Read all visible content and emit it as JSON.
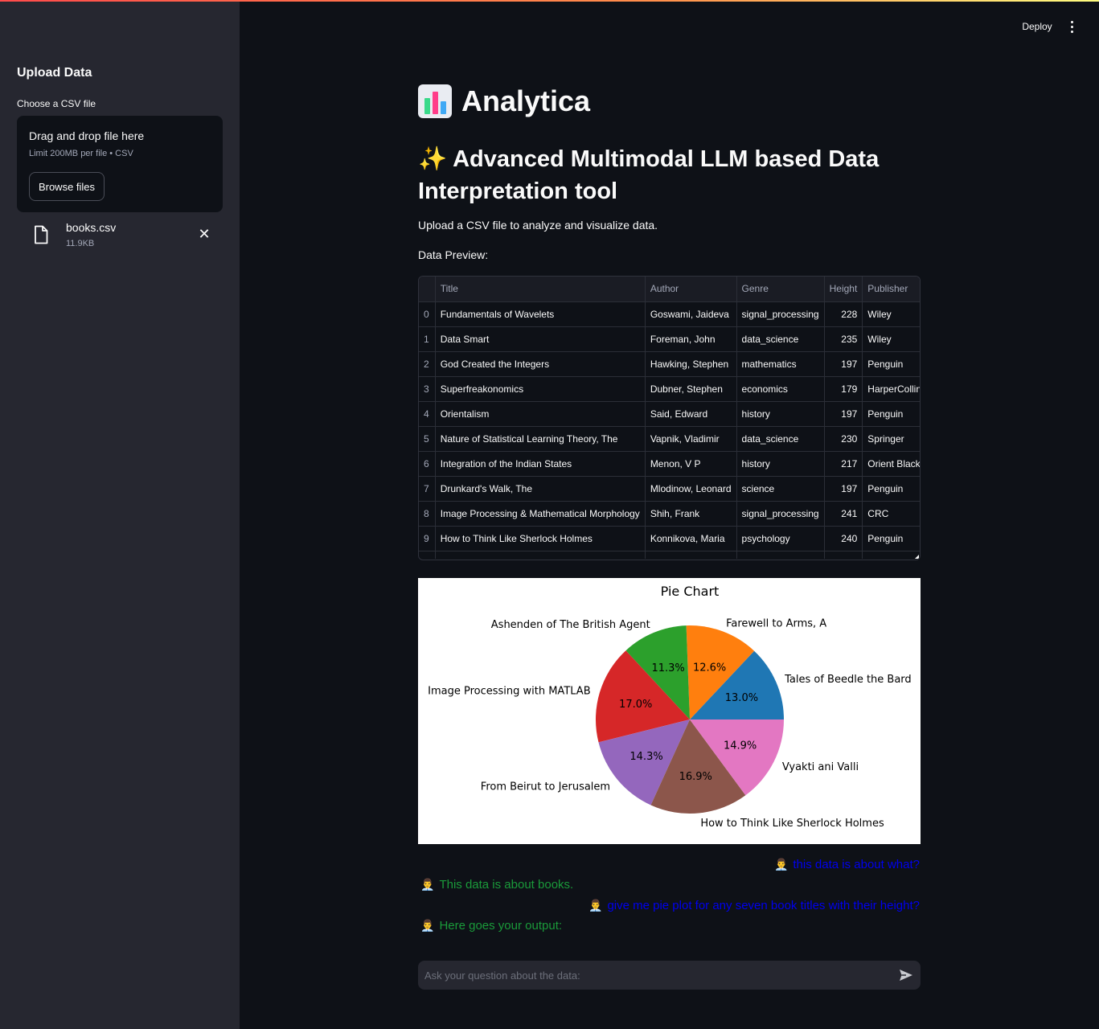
{
  "header": {
    "deploy_label": "Deploy",
    "menu_icon": "kebab-menu-icon"
  },
  "sidebar": {
    "title": "Upload Data",
    "uploader_label": "Choose a CSV file",
    "dropzone_title": "Drag and drop file here",
    "dropzone_limit": "Limit 200MB per file • CSV",
    "browse_label": "Browse files",
    "file": {
      "name": "books.csv",
      "size": "11.9KB"
    }
  },
  "main": {
    "title": "Analytica",
    "title_icon": "bar-chart-icon",
    "subtitle_icon": "✨",
    "subtitle": "Advanced Multimodal LLM based Data Interpretation tool",
    "intro": "Upload a CSV file to analyze and visualize data.",
    "preview_label": "Data Preview:"
  },
  "table": {
    "columns": [
      "",
      "Title",
      "Author",
      "Genre",
      "Height",
      "Publisher"
    ],
    "rows": [
      [
        "0",
        "Fundamentals of Wavelets",
        "Goswami, Jaideva",
        "signal_processing",
        "228",
        "Wiley"
      ],
      [
        "1",
        "Data Smart",
        "Foreman, John",
        "data_science",
        "235",
        "Wiley"
      ],
      [
        "2",
        "God Created the Integers",
        "Hawking, Stephen",
        "mathematics",
        "197",
        "Penguin"
      ],
      [
        "3",
        "Superfreakonomics",
        "Dubner, Stephen",
        "economics",
        "179",
        "HarperCollins"
      ],
      [
        "4",
        "Orientalism",
        "Said, Edward",
        "history",
        "197",
        "Penguin"
      ],
      [
        "5",
        "Nature of Statistical Learning Theory, The",
        "Vapnik, Vladimir",
        "data_science",
        "230",
        "Springer"
      ],
      [
        "6",
        "Integration of the Indian States",
        "Menon, V P",
        "history",
        "217",
        "Orient Blackswan"
      ],
      [
        "7",
        "Drunkard's Walk, The",
        "Mlodinow, Leonard",
        "science",
        "197",
        "Penguin"
      ],
      [
        "8",
        "Image Processing & Mathematical Morphology",
        "Shih, Frank",
        "signal_processing",
        "241",
        "CRC"
      ],
      [
        "9",
        "How to Think Like Sherlock Holmes",
        "Konnikova, Maria",
        "psychology",
        "240",
        "Penguin"
      ]
    ]
  },
  "chart_data": {
    "type": "pie",
    "title": "Pie Chart",
    "labels": [
      "Tales of Beedle the Bard",
      "Farewell to Arms, A",
      "Ashenden of The British Agent",
      "Image Processing with MATLAB",
      "From Beirut to Jerusalem",
      "How to Think Like Sherlock Holmes",
      "Vyakti ani Valli"
    ],
    "percent_labels": [
      "13.0%",
      "12.6%",
      "11.3%",
      "17.0%",
      "14.3%",
      "16.9%",
      "14.9%"
    ],
    "values": [
      13.0,
      12.6,
      11.3,
      17.0,
      14.3,
      16.9,
      14.9
    ],
    "colors": [
      "#1f77b4",
      "#ff7f0e",
      "#2ca02c",
      "#d62728",
      "#9467bd",
      "#8c564b",
      "#e377c2"
    ],
    "start_angle_deg": 0,
    "direction": "counterclockwise"
  },
  "chat": {
    "messages": [
      {
        "role": "user",
        "avatar": "👨‍💼",
        "text": "this data is about what?"
      },
      {
        "role": "bot",
        "avatar": "👨‍💼",
        "text": "This data is about books."
      },
      {
        "role": "user",
        "avatar": "👨‍💼",
        "text": "give me pie plot for any seven book titles with their height?"
      },
      {
        "role": "bot",
        "avatar": "👨‍💼",
        "text": "Here goes your output:"
      }
    ],
    "input_placeholder": "Ask your question about the data:",
    "send_icon": "send-icon"
  }
}
